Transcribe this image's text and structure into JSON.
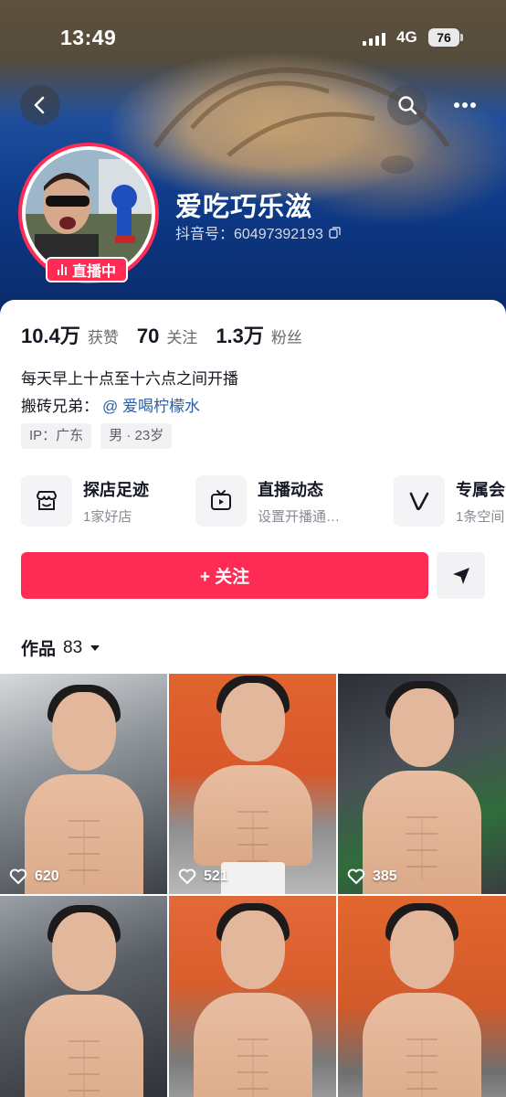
{
  "status_bar": {
    "time": "13:49",
    "network": "4G",
    "battery": "76"
  },
  "profile": {
    "nickname": "爱吃巧乐滋",
    "douyin_id": "抖音号：60497392193",
    "live_badge": "直播中"
  },
  "stats": [
    {
      "value": "10.4万",
      "label": "获赞"
    },
    {
      "value": "70",
      "label": "关注"
    },
    {
      "value": "1.3万",
      "label": "粉丝"
    }
  ],
  "bio": {
    "line1": "每天早上十点至十六点之间开播",
    "line2_prefix": "搬砖兄弟：",
    "line2_mention": "@ 爱喝柠檬水"
  },
  "tags": [
    "IP：广东",
    "男 · 23岁"
  ],
  "features": [
    {
      "title": "探店足迹",
      "subtitle": "1家好店",
      "icon": "shop-icon"
    },
    {
      "title": "直播动态",
      "subtitle": "设置开播通…",
      "icon": "tv-icon"
    },
    {
      "title": "专属会",
      "subtitle": "1条空间",
      "icon": "v-logo-icon"
    }
  ],
  "actions": {
    "follow_label": "+ 关注"
  },
  "works_tab": {
    "label": "作品",
    "count": "83"
  },
  "videos": [
    {
      "likes": "620"
    },
    {
      "likes": "521"
    },
    {
      "likes": "385"
    },
    {
      "likes": ""
    },
    {
      "likes": ""
    },
    {
      "likes": ""
    }
  ],
  "colors": {
    "accent": "#fe2c55",
    "mention": "#2a5fa6",
    "cover_blue": "#0f3f93"
  }
}
